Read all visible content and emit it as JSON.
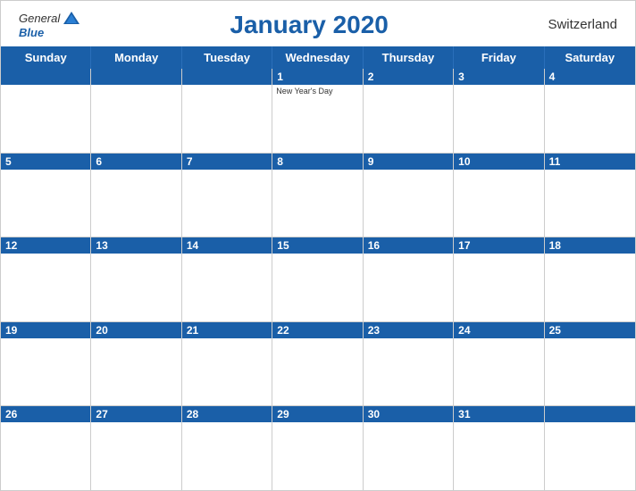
{
  "header": {
    "title": "January 2020",
    "country": "Switzerland",
    "logo": {
      "general": "General",
      "blue": "Blue"
    }
  },
  "dayHeaders": [
    "Sunday",
    "Monday",
    "Tuesday",
    "Wednesday",
    "Thursday",
    "Friday",
    "Saturday"
  ],
  "weeks": [
    [
      {
        "day": "",
        "empty": true
      },
      {
        "day": "",
        "empty": true
      },
      {
        "day": "",
        "empty": true
      },
      {
        "day": "1",
        "holiday": "New Year's Day"
      },
      {
        "day": "2"
      },
      {
        "day": "3"
      },
      {
        "day": "4"
      }
    ],
    [
      {
        "day": "5"
      },
      {
        "day": "6"
      },
      {
        "day": "7"
      },
      {
        "day": "8"
      },
      {
        "day": "9"
      },
      {
        "day": "10"
      },
      {
        "day": "11"
      }
    ],
    [
      {
        "day": "12"
      },
      {
        "day": "13"
      },
      {
        "day": "14"
      },
      {
        "day": "15"
      },
      {
        "day": "16"
      },
      {
        "day": "17"
      },
      {
        "day": "18"
      }
    ],
    [
      {
        "day": "19"
      },
      {
        "day": "20"
      },
      {
        "day": "21"
      },
      {
        "day": "22"
      },
      {
        "day": "23"
      },
      {
        "day": "24"
      },
      {
        "day": "25"
      }
    ],
    [
      {
        "day": "26"
      },
      {
        "day": "27"
      },
      {
        "day": "28"
      },
      {
        "day": "29"
      },
      {
        "day": "30"
      },
      {
        "day": "31"
      },
      {
        "day": "",
        "empty": true
      }
    ]
  ]
}
